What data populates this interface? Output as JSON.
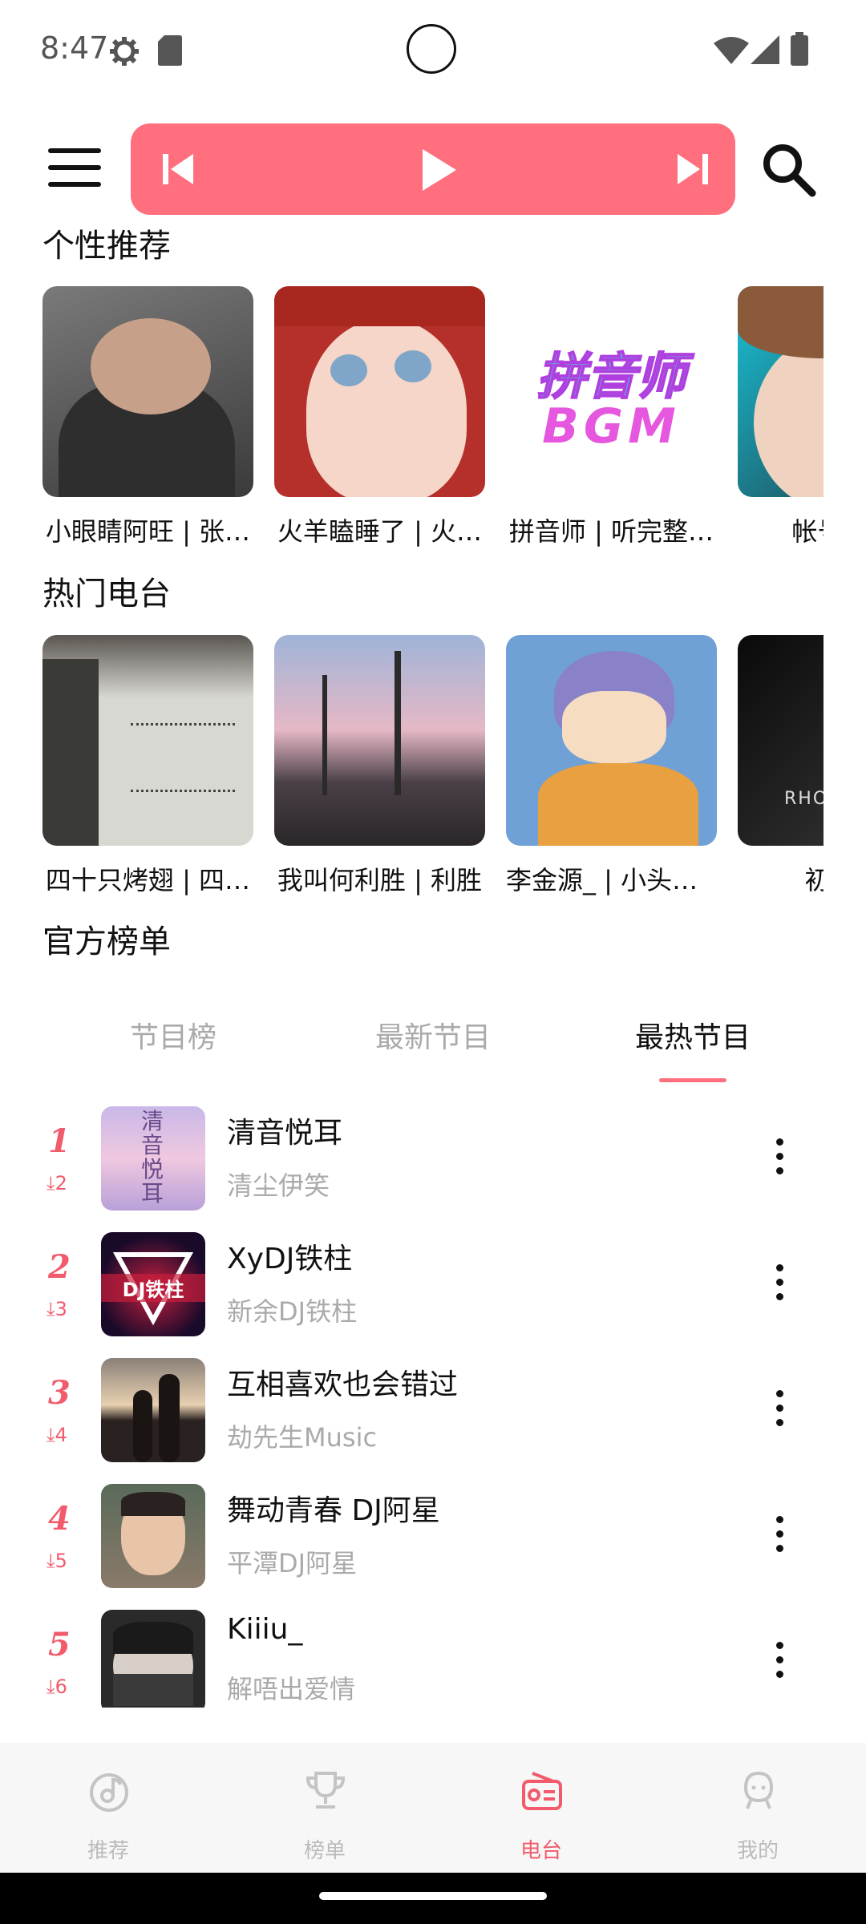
{
  "status_bar": {
    "time": "8:47"
  },
  "sections": {
    "personal": "个性推荐",
    "hot_radio": "热门电台",
    "official": "官方榜单"
  },
  "personal_cards": [
    {
      "title": "小眼睛阿旺 | 张…",
      "cover": "#5a5a5a"
    },
    {
      "title": "火羊瞌睡了 | 火…",
      "cover": "#b5302a"
    },
    {
      "title": "拼音师 | 听完整…",
      "cover": "#ffffff",
      "cover_text": "拼音师",
      "cover_text2": "BGM"
    },
    {
      "title": "帐号已注",
      "cover": "#2a5a78"
    }
  ],
  "hot_cards": [
    {
      "title": "四十只烤翅 | 四…",
      "cover": "#d8d8d2"
    },
    {
      "title": "我叫何利胜 | 利胜",
      "cover": "#8a7a8c"
    },
    {
      "title": "李金源_ | 小头的…",
      "cover": "#6fa0d6"
    },
    {
      "title": "初弦__",
      "cover": "#1c1c1c",
      "cover_text": "RHO"
    }
  ],
  "tabs": [
    {
      "label": "节目榜",
      "active": false
    },
    {
      "label": "最新节目",
      "active": false
    },
    {
      "label": "最热节目",
      "active": true
    }
  ],
  "rank_items": [
    {
      "rank": "1",
      "change": "2",
      "title": "清音悦耳",
      "subtitle": "清尘伊笑",
      "thumb": "#e2c4e6",
      "thumb_text": "清音悦耳"
    },
    {
      "rank": "2",
      "change": "3",
      "title": "XyDJ铁柱",
      "subtitle": "新余DJ铁柱",
      "thumb": "#1a0a2a",
      "thumb_text": "DJ铁柱"
    },
    {
      "rank": "3",
      "change": "4",
      "title": "互相喜欢也会错过",
      "subtitle": "劫先生Music",
      "thumb": "#3a3030"
    },
    {
      "rank": "4",
      "change": "5",
      "title": "舞动青春 DJ阿星",
      "subtitle": "平潭DJ阿星",
      "thumb": "#6a5a50"
    },
    {
      "rank": "5",
      "change": "6",
      "title": "Kiiiu_",
      "subtitle": "解唔出爱情",
      "thumb": "#2a2a2a"
    }
  ],
  "nav": [
    {
      "label": "推荐",
      "icon": "music-disc-icon",
      "active": false
    },
    {
      "label": "榜单",
      "icon": "trophy-icon",
      "active": false
    },
    {
      "label": "电台",
      "icon": "radio-icon",
      "active": true
    },
    {
      "label": "我的",
      "icon": "person-icon",
      "active": false
    }
  ],
  "colors": {
    "accent": "#ff6f7e",
    "rank_red": "#f15b6c"
  }
}
